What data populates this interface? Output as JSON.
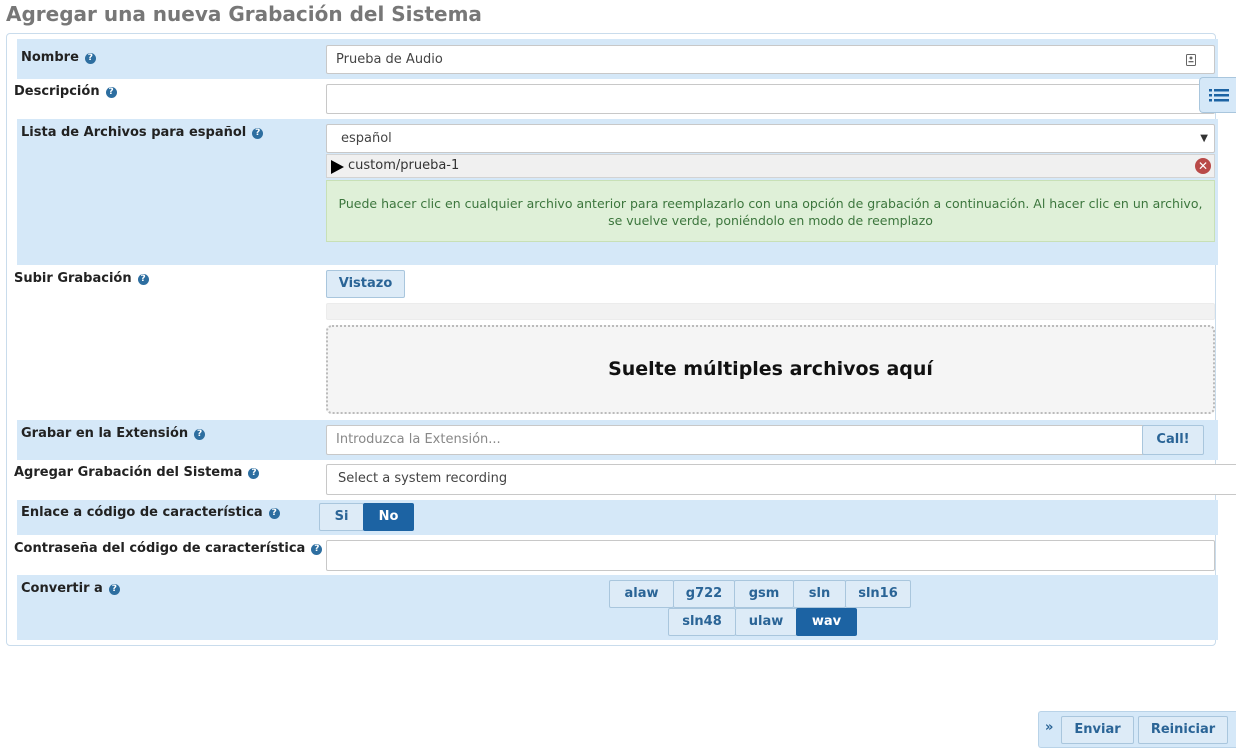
{
  "page": {
    "title": "Agregar una nueva Grabación del Sistema"
  },
  "form": {
    "nombre": {
      "label": "Nombre",
      "value": "Prueba de Audio"
    },
    "descripcion": {
      "label": "Descripción",
      "value": ""
    },
    "lista": {
      "label": "Lista de Archivos para español",
      "language_selected": "español",
      "file": "custom/prueba-1",
      "info": "Puede hacer clic en cualquier archivo anterior para reemplazarlo con una opción de grabación a continuación. Al hacer clic en un archivo, se vuelve verde, poniéndolo en modo de reemplazo"
    },
    "subir": {
      "label": "Subir Grabación",
      "browse_label": "Vistazo",
      "dropzone_text": "Suelte múltiples archivos aquí"
    },
    "grabar": {
      "label": "Grabar en la Extensión",
      "placeholder": "Introduzca la Extensión...",
      "call_label": "Call!"
    },
    "agregar": {
      "label": "Agregar Grabación del Sistema",
      "placeholder": "Select a system recording"
    },
    "enlace": {
      "label": "Enlace a código de característica",
      "options": [
        "Si",
        "No"
      ],
      "selected": "No"
    },
    "contrasena": {
      "label": "Contraseña del código de característica",
      "value": ""
    },
    "convertir": {
      "label": "Convertir a",
      "row1": [
        "alaw",
        "g722",
        "gsm",
        "sln",
        "sln16"
      ],
      "row2": [
        "sln48",
        "ulaw",
        "wav"
      ],
      "selected": [
        "wav"
      ]
    }
  },
  "footer": {
    "submit_label": "Enviar",
    "reset_label": "Reiniciar",
    "expand_icon": "double-chevron-right-icon"
  },
  "icons": {
    "help": "question-circle-icon",
    "list_toggle": "list-icon",
    "play": "play-icon",
    "remove": "remove-circle-icon",
    "input_addon": "contact-card-icon"
  },
  "colors": {
    "row_alt": "#d5e8f8",
    "accent": "#1c63a3",
    "success_bg": "#dff0d8",
    "danger": "#b94a48"
  }
}
